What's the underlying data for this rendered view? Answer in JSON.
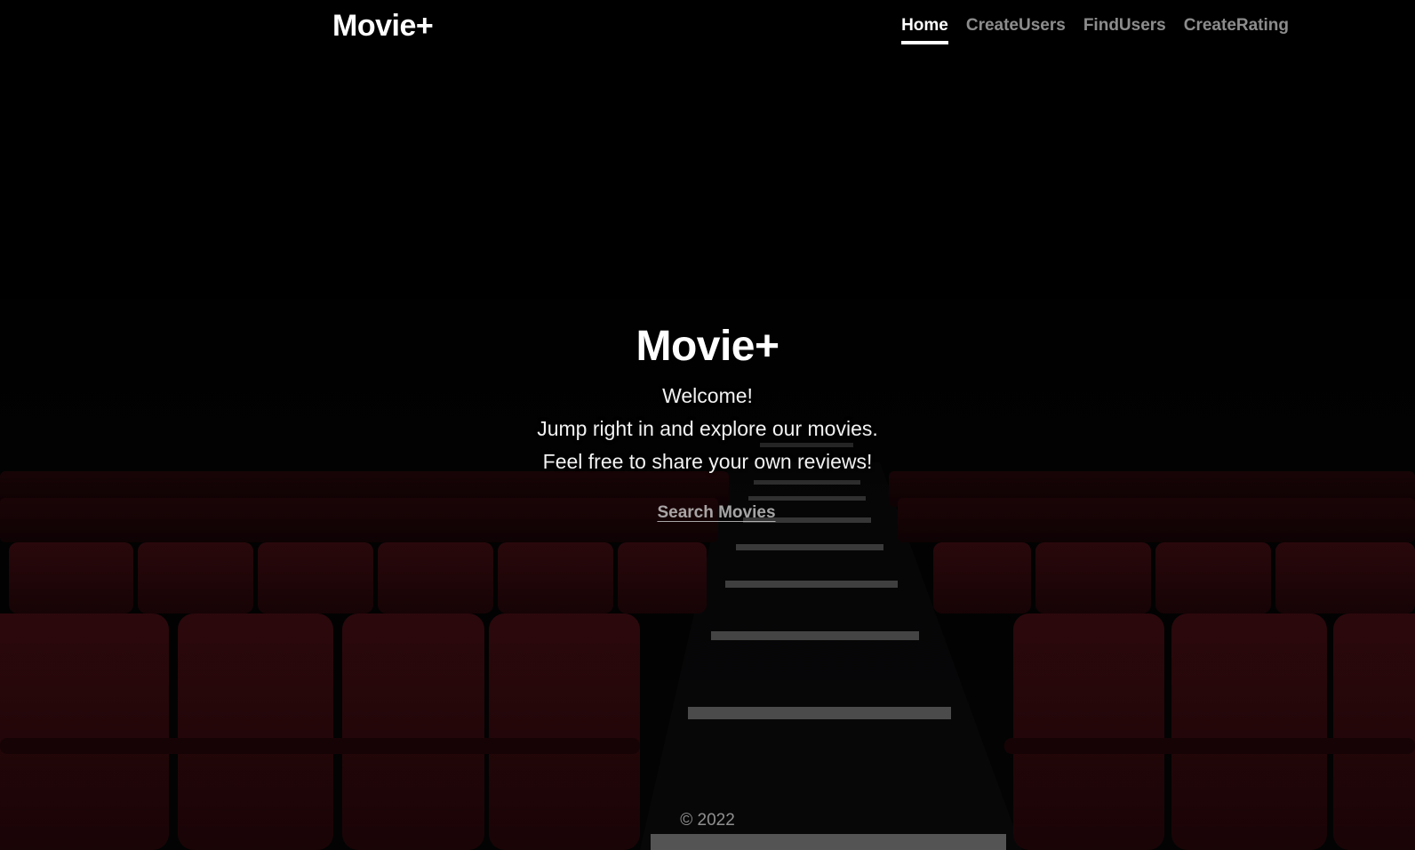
{
  "header": {
    "brand": "Movie+",
    "nav": [
      {
        "label": "Home",
        "active": true
      },
      {
        "label": "CreateUsers",
        "active": false
      },
      {
        "label": "FindUsers",
        "active": false
      },
      {
        "label": "CreateRating",
        "active": false
      }
    ]
  },
  "hero": {
    "title": "Movie+",
    "lines": [
      "Welcome!",
      "Jump right in and explore our movies.",
      "Feel free to share your own reviews!"
    ],
    "button_label": "Search Movies"
  },
  "footer": {
    "copyright": "© 2022"
  },
  "colors": {
    "background": "#000000",
    "seat_red": "#4a0d12",
    "text": "#ffffff"
  }
}
